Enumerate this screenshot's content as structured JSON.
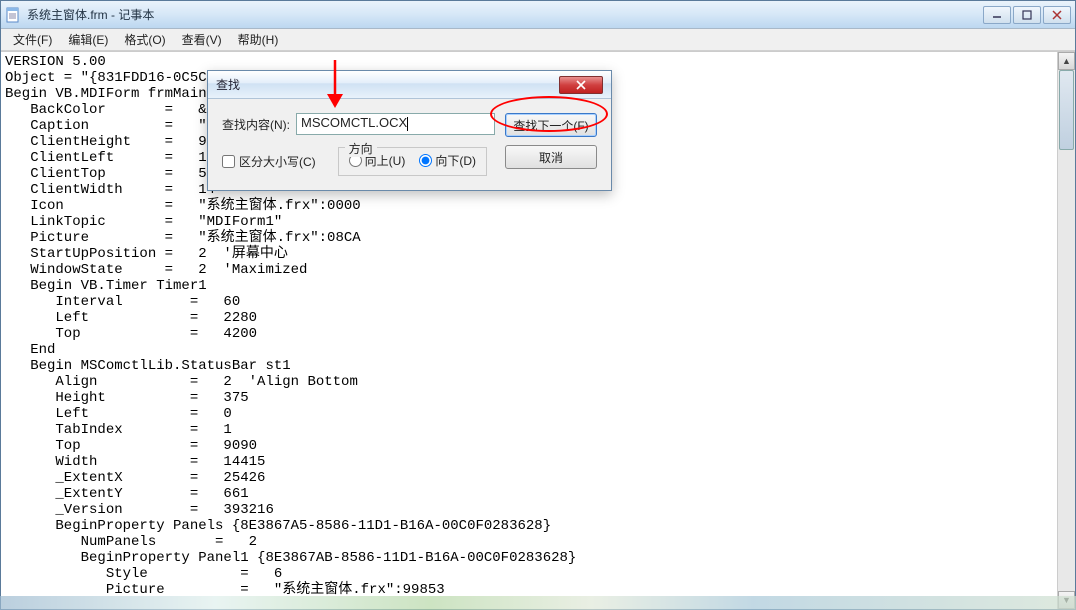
{
  "window": {
    "title": "系统主窗体.frm - 记事本"
  },
  "menubar": {
    "file": "文件(F)",
    "edit": "编辑(E)",
    "format": "格式(O)",
    "view": "查看(V)",
    "help": "帮助(H)"
  },
  "document_text": "VERSION 5.00\nObject = \"{831FDD16-0C5C-\nBegin VB.MDIForm frmMain\n   BackColor       =   &H\n   Caption         =   \"才\n   ClientHeight    =   94\n   ClientLeft      =   16\n   ClientTop       =   54\n   ClientWidth     =   14\n   Icon            =   \"系统主窗体.frx\":0000\n   LinkTopic       =   \"MDIForm1\"\n   Picture         =   \"系统主窗体.frx\":08CA\n   StartUpPosition =   2  '屏幕中心\n   WindowState     =   2  'Maximized\n   Begin VB.Timer Timer1 \n      Interval        =   60\n      Left            =   2280\n      Top             =   4200\n   End\n   Begin MSComctlLib.StatusBar st1 \n      Align           =   2  'Align Bottom\n      Height          =   375\n      Left            =   0\n      TabIndex        =   1\n      Top             =   9090\n      Width           =   14415\n      _ExtentX        =   25426\n      _ExtentY        =   661\n      _Version        =   393216\n      BeginProperty Panels {8E3867A5-8586-11D1-B16A-00C0F0283628} \n         NumPanels       =   2\n         BeginProperty Panel1 {8E3867AB-8586-11D1-B16A-00C0F0283628} \n            Style           =   6\n            Picture         =   \"系统主窗体.frx\":99853",
  "find": {
    "title": "查找",
    "content_label": "查找内容(N):",
    "input_value": "MSCOMCTL.OCX",
    "next_button": "查找下一个(F)",
    "cancel_button": "取消",
    "case_label": "区分大小写(C)",
    "case_checked": false,
    "direction_legend": "方向",
    "dir_up": "向上(U)",
    "dir_down": "向下(D)",
    "dir_selected": "down"
  }
}
